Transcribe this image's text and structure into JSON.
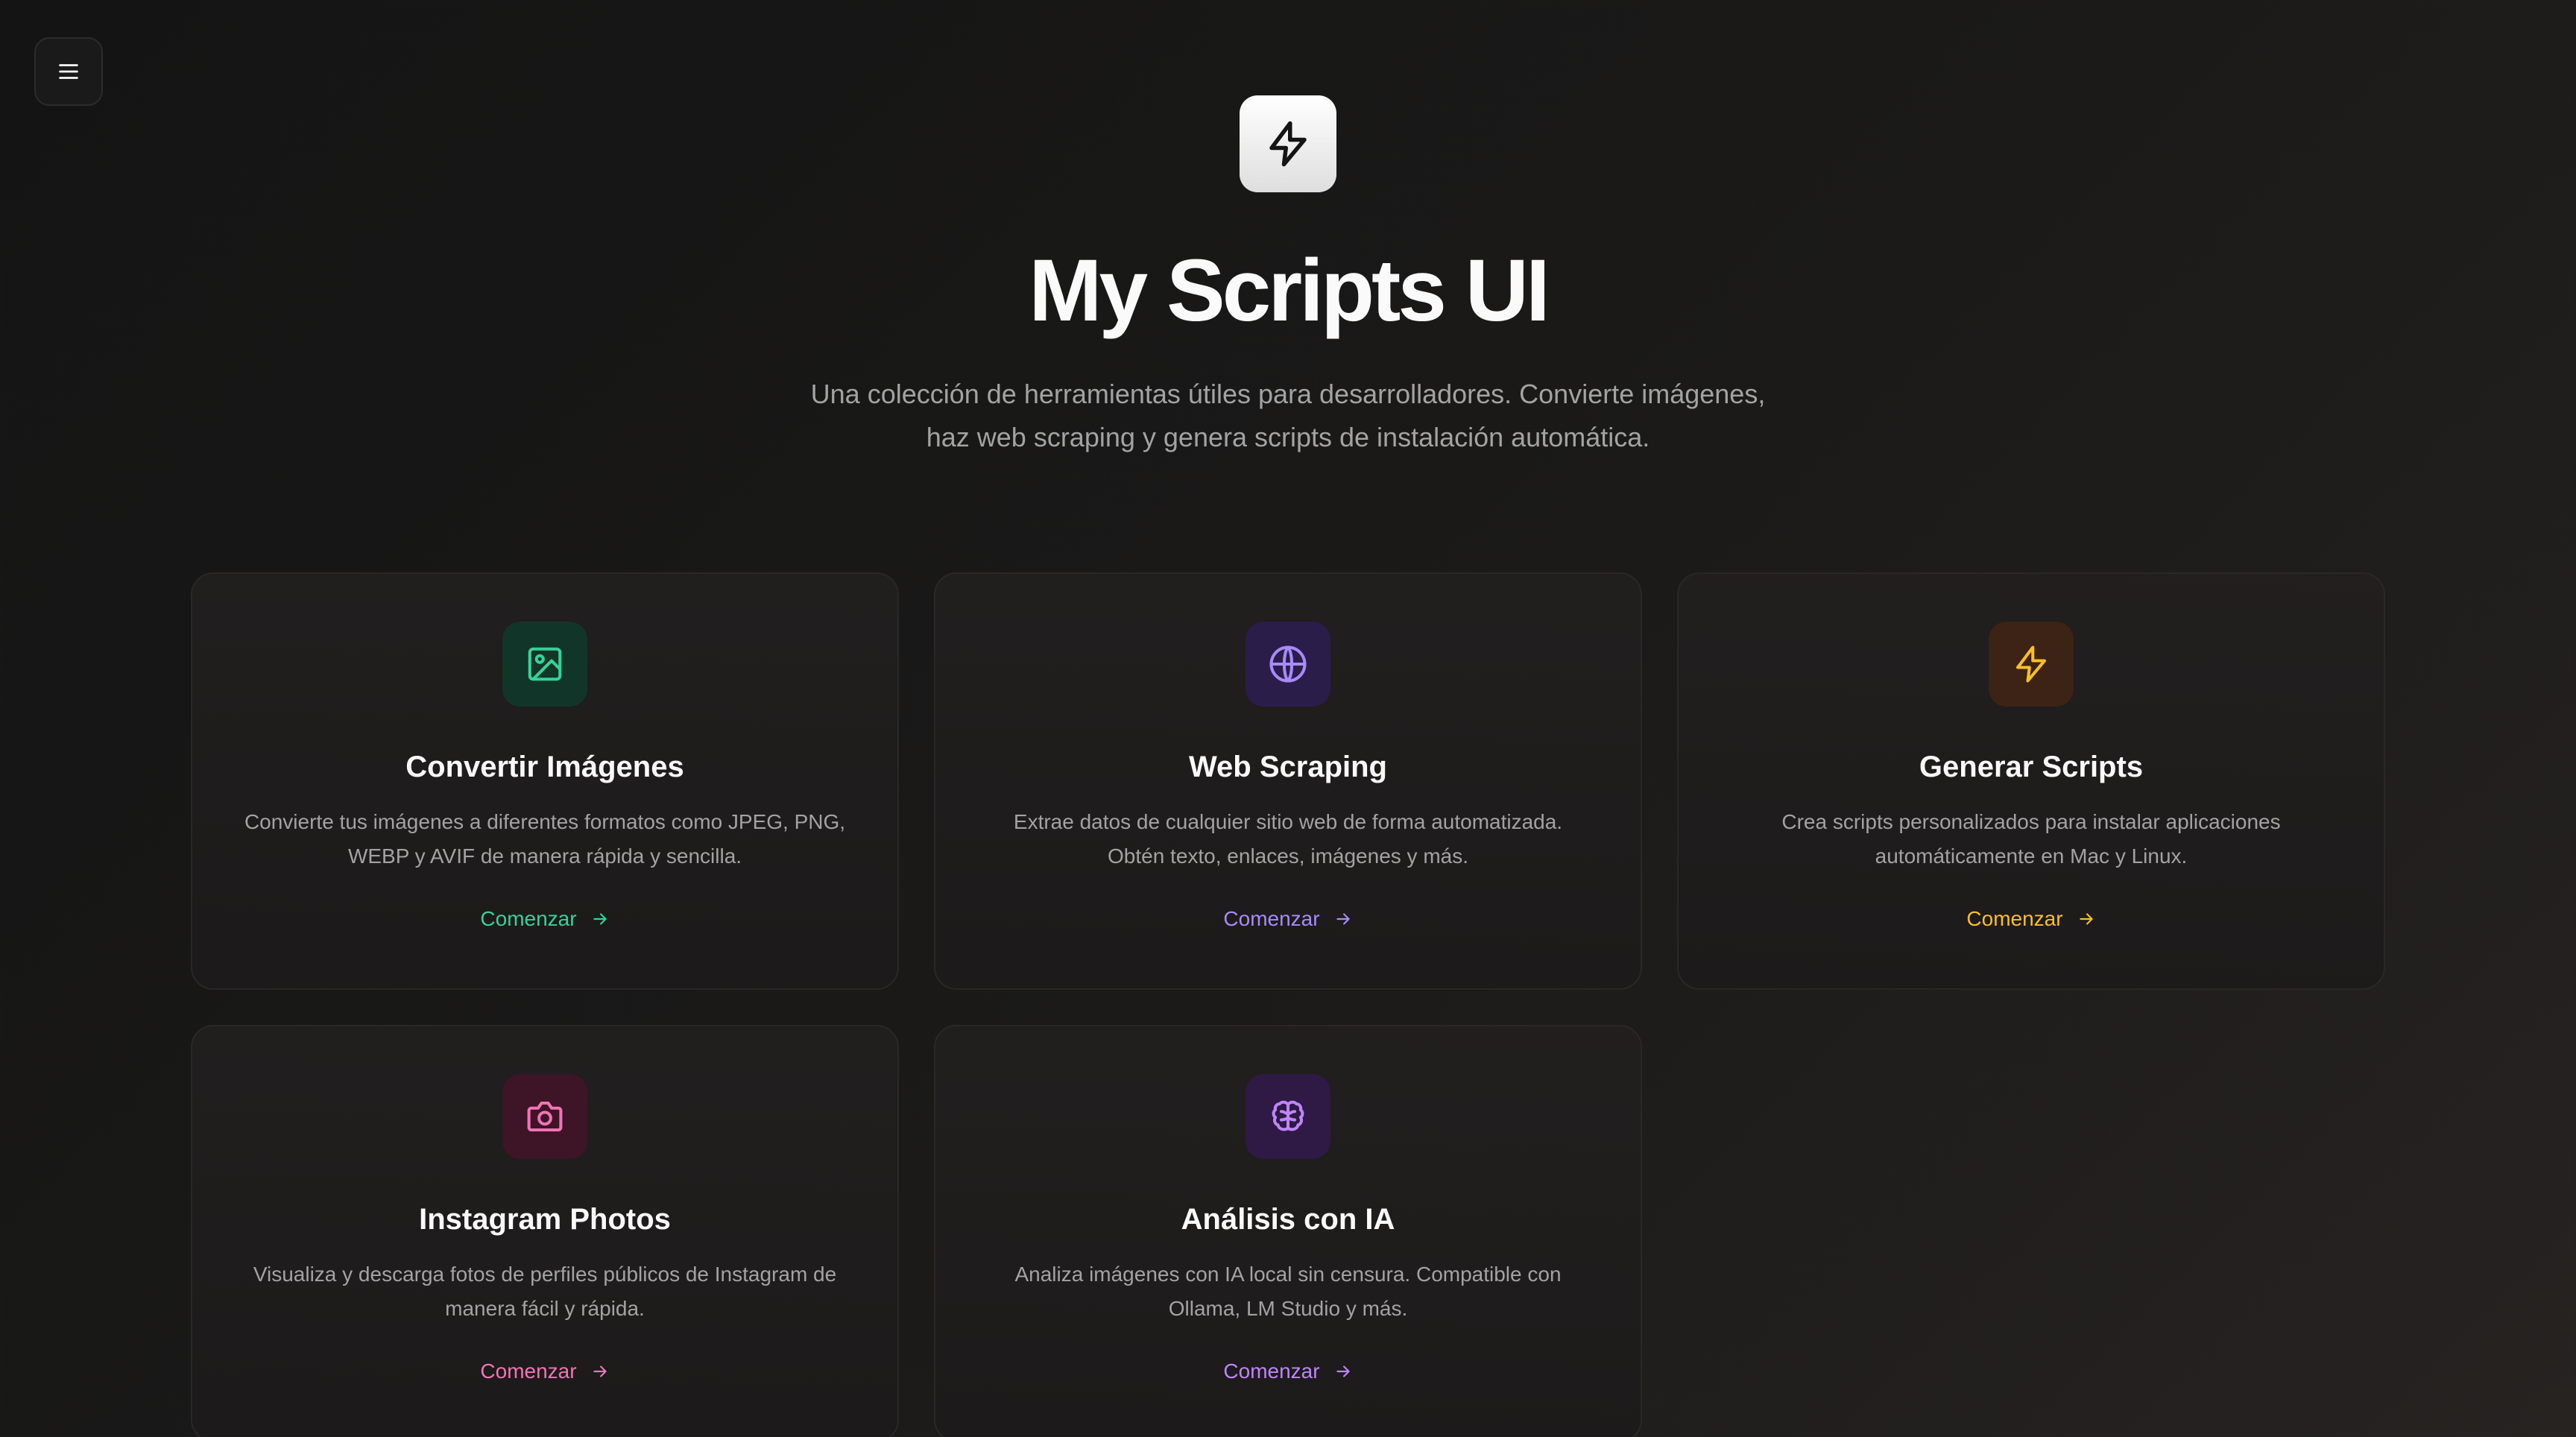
{
  "hero": {
    "title": "My Scripts UI",
    "subtitle": "Una colección de herramientas útiles para desarrolladores. Convierte imágenes, haz web scraping y genera scripts de instalación automática."
  },
  "cards": [
    {
      "title": "Convertir Imágenes",
      "description": "Convierte tus imágenes a diferentes formatos como JPEG, PNG, WEBP y AVIF de manera rápida y sencilla.",
      "link_label": "Comenzar",
      "icon": "image-icon",
      "accent": "#34d399",
      "icon_bg": "#12352a"
    },
    {
      "title": "Web Scraping",
      "description": "Extrae datos de cualquier sitio web de forma automatizada. Obtén texto, enlaces, imágenes y más.",
      "link_label": "Comenzar",
      "icon": "globe-icon",
      "accent": "#a78bfa",
      "icon_bg": "#2a1d4a"
    },
    {
      "title": "Generar Scripts",
      "description": "Crea scripts personalizados para instalar aplicaciones automáticamente en Mac y Linux.",
      "link_label": "Comenzar",
      "icon": "lightning-icon",
      "accent": "#fbbf24",
      "icon_bg": "#3d2315"
    },
    {
      "title": "Instagram Photos",
      "description": "Visualiza y descarga fotos de perfiles públicos de Instagram de manera fácil y rápida.",
      "link_label": "Comenzar",
      "icon": "camera-icon",
      "accent": "#f472b6",
      "icon_bg": "#3d1526"
    },
    {
      "title": "Análisis con IA",
      "description": "Analiza imágenes con IA local sin censura. Compatible con Ollama, LM Studio y más.",
      "link_label": "Comenzar",
      "icon": "brain-icon",
      "accent": "#c084fc",
      "icon_bg": "#2e1a45"
    }
  ]
}
